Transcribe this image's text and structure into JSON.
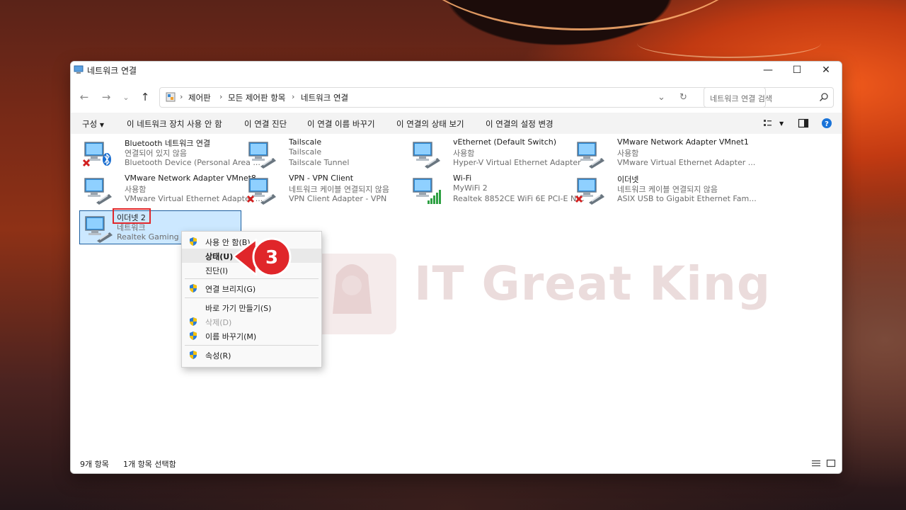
{
  "window": {
    "title": "네트워크 연결"
  },
  "address": {
    "crumbs": [
      "제어판",
      "모든 제어판 항목",
      "네트워크 연결"
    ],
    "search_placeholder": "네트워크 연결 검색"
  },
  "toolbar": {
    "organize": "구성",
    "disable": "이 네트워크 장치 사용 안 함",
    "diagnose": "이 연결 진단",
    "rename": "이 연결 이름 바꾸기",
    "status": "이 연결의 상태 보기",
    "settings": "이 연결의 설정 변경"
  },
  "adapters": [
    {
      "name": "Bluetooth 네트워크 연결",
      "status": "연결되어 있지 않음",
      "device": "Bluetooth Device (Personal Area ...",
      "icon": "network-adapter-bluetooth-disconnected-icon"
    },
    {
      "name": "Tailscale",
      "status": "Tailscale",
      "device": "Tailscale Tunnel",
      "icon": "network-adapter-cable-icon"
    },
    {
      "name": "vEthernet (Default Switch)",
      "status": "사용함",
      "device": "Hyper-V Virtual Ethernet Adapter",
      "icon": "network-adapter-cable-icon"
    },
    {
      "name": "VMware Network Adapter VMnet1",
      "status": "사용함",
      "device": "VMware Virtual Ethernet Adapter ...",
      "icon": "network-adapter-cable-icon"
    },
    {
      "name": "VMware Network Adapter VMnet8",
      "status": "사용함",
      "device": "VMware Virtual Ethernet Adapter ...",
      "icon": "network-adapter-cable-icon"
    },
    {
      "name": "VPN - VPN Client",
      "status": "네트워크 케이블 연결되지 않음",
      "device": "VPN Client Adapter - VPN",
      "icon": "network-adapter-disconnected-icon"
    },
    {
      "name": "Wi-Fi",
      "status": "MyWiFi 2",
      "device": "Realtek 8852CE WiFi 6E PCI-E NIC",
      "icon": "wifi-adapter-icon"
    },
    {
      "name": "이더넷",
      "status": "네트워크 케이블 연결되지 않음",
      "device": "ASIX USB to Gigabit Ethernet Fam...",
      "icon": "network-adapter-disconnected-icon"
    },
    {
      "name": "이더넷 2",
      "status": "네트워크",
      "device": "Realtek Gaming 2.5",
      "icon": "network-adapter-cable-icon"
    }
  ],
  "context_menu": {
    "disable": "사용 안 함(B)",
    "status": "상태(U)",
    "diagnose": "진단(I)",
    "bridge": "연결 브리지(G)",
    "shortcut": "바로 가기 만들기(S)",
    "delete": "삭제(D)",
    "rename": "이름 바꾸기(M)",
    "properties": "속성(R)"
  },
  "statusbar": {
    "count": "9개 항목",
    "selected": "1개 항목 선택함"
  },
  "annotation": {
    "step": "3"
  },
  "watermark": {
    "text": "IT Great King"
  },
  "colors": {
    "highlight": "#e0262a",
    "selection": "#cce8ff",
    "accent": "#0078d4"
  }
}
